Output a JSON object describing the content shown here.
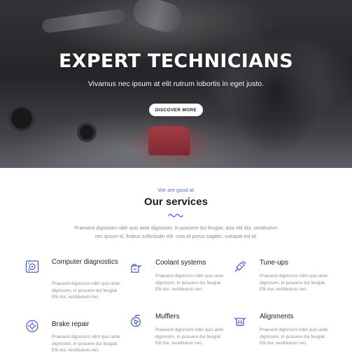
{
  "hero": {
    "title": "EXPERT TECHNICIANS",
    "subtitle": "Vivamus nec ipsum at elit rutrum lobortis in eget justo.",
    "button_label": "DISCOVER MORE"
  },
  "services": {
    "eyebrow": "We are good at",
    "title": "Our services",
    "intro": "Praesent dignissim nibh quis ante dignissim, in posuere dui feugiat. duis elit dui, vestibulum nec ipsum id, finibus sollicitudin elit. cras et purus sagittis, volutpat est id.",
    "accent_color": "#5a6fd6",
    "items": [
      {
        "title": "Computer diagnostics",
        "icon": "computer-diagnostics-icon",
        "desc": "Praesent dignissim nibh quis ante dignissim, in posuere dui feugiat. Elit dui, vestibulum nec."
      },
      {
        "title": "Coolant systems",
        "icon": "coolant-can-icon",
        "desc": "Praesent dignissim nibh quis ante dignissim, in posuere dui feugiat. Elit dui, vestibulum nec."
      },
      {
        "title": "Tune-ups",
        "icon": "spark-plug-icon",
        "desc": "Praesent dignissim nibh quis ante dignissim, in posuere dui feugiat. Elit dui, vestibulum nec."
      },
      {
        "title": "Brake repair",
        "icon": "brake-disc-icon",
        "desc": "Praesent dignissim nibh quis ante dignissim, in posuere dui feugiat. Elit dui, vestibulum nec."
      },
      {
        "title": "Mufflers",
        "icon": "turbo-muffler-icon",
        "desc": "Praesent dignissim nibh quis ante dignissim, in posuere dui feugiat. Elit dui, vestibulum nec."
      },
      {
        "title": "Alignments",
        "icon": "engine-icon",
        "desc": "Praesent dignissim nibh quis ante dignissim, in posuere dui feugiat. Elit dui, vestibulum nec."
      }
    ]
  }
}
